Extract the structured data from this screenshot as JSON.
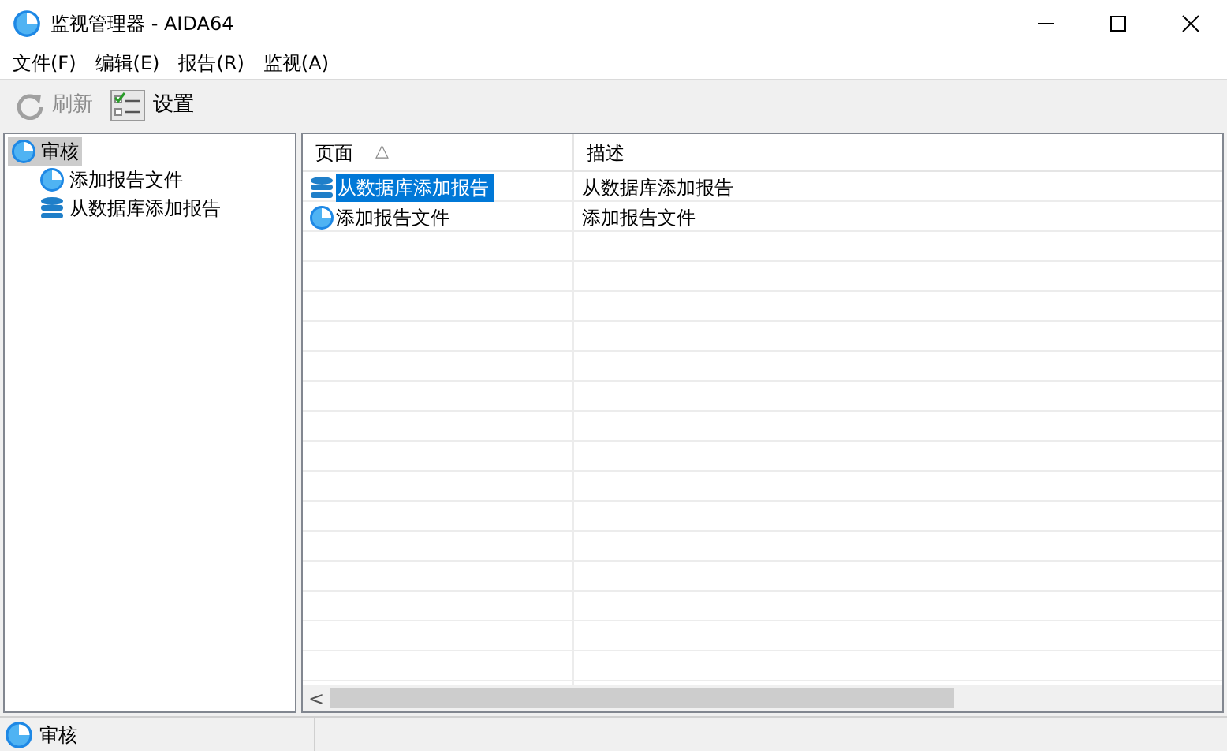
{
  "window": {
    "title": "监视管理器 - AIDA64"
  },
  "menu": [
    "文件(F)",
    "编辑(E)",
    "报告(R)",
    "监视(A)"
  ],
  "toolbar": [
    {
      "label": "刷新",
      "kind": "refresh",
      "disabled": true
    },
    {
      "label": "设置",
      "kind": "settings",
      "disabled": false
    }
  ],
  "tree": [
    {
      "label": "审核",
      "kind": "report",
      "selected": true,
      "children": [
        {
          "label": "添加报告文件",
          "kind": "report",
          "selected": false
        },
        {
          "label": "从数据库添加报告",
          "kind": "database",
          "selected": false
        }
      ]
    }
  ],
  "table": {
    "columns": [
      {
        "label": "页面",
        "sort": "△"
      },
      {
        "label": "描述"
      }
    ],
    "rows": [
      {
        "kind": "database",
        "selected": true,
        "cells": [
          "从数据库添加报告",
          "从数据库添加报告"
        ]
      },
      {
        "kind": "report",
        "selected": false,
        "cells": [
          "添加报告文件",
          "添加报告文件"
        ]
      }
    ],
    "scrollbar_arrow": "<"
  },
  "status_bar": {
    "kind": "report",
    "text": "审核"
  }
}
